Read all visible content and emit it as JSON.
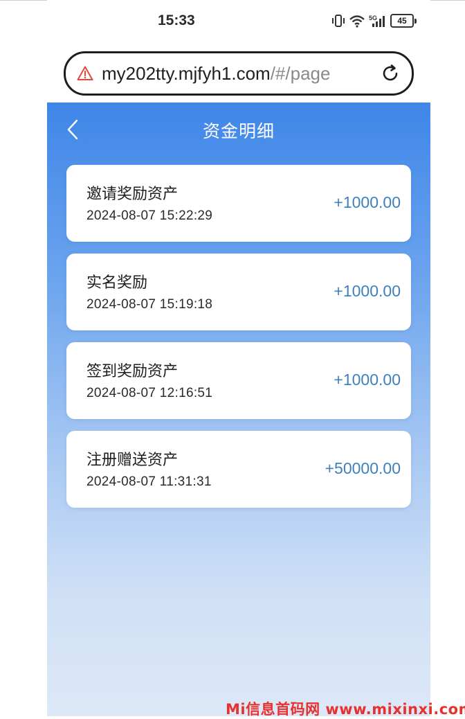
{
  "status_bar": {
    "time": "15:33",
    "battery": "45"
  },
  "browser": {
    "url_host": "my202tty.mjfyh1.com",
    "url_path": "/#/page",
    "icons": [
      "warning-icon",
      "reload-icon"
    ],
    "warning_color": "#e04a3a"
  },
  "header": {
    "title": "资金明细",
    "back_icon": "chevron-left-icon"
  },
  "records": [
    {
      "name": "邀请奖励资产",
      "time": "2024-08-07 15:22:29",
      "amount": "+1000.00"
    },
    {
      "name": "实名奖励",
      "time": "2024-08-07 15:19:18",
      "amount": "+1000.00"
    },
    {
      "name": "签到奖励资产",
      "time": "2024-08-07 12:16:51",
      "amount": "+1000.00"
    },
    {
      "name": "注册赠送资产",
      "time": "2024-08-07 11:31:31",
      "amount": "+50000.00"
    }
  ],
  "colors": {
    "header_blue": "#3f86e8",
    "amount_blue": "#3f7fc0"
  },
  "watermark": "Mi信息首码网 www.mixinxi.com"
}
